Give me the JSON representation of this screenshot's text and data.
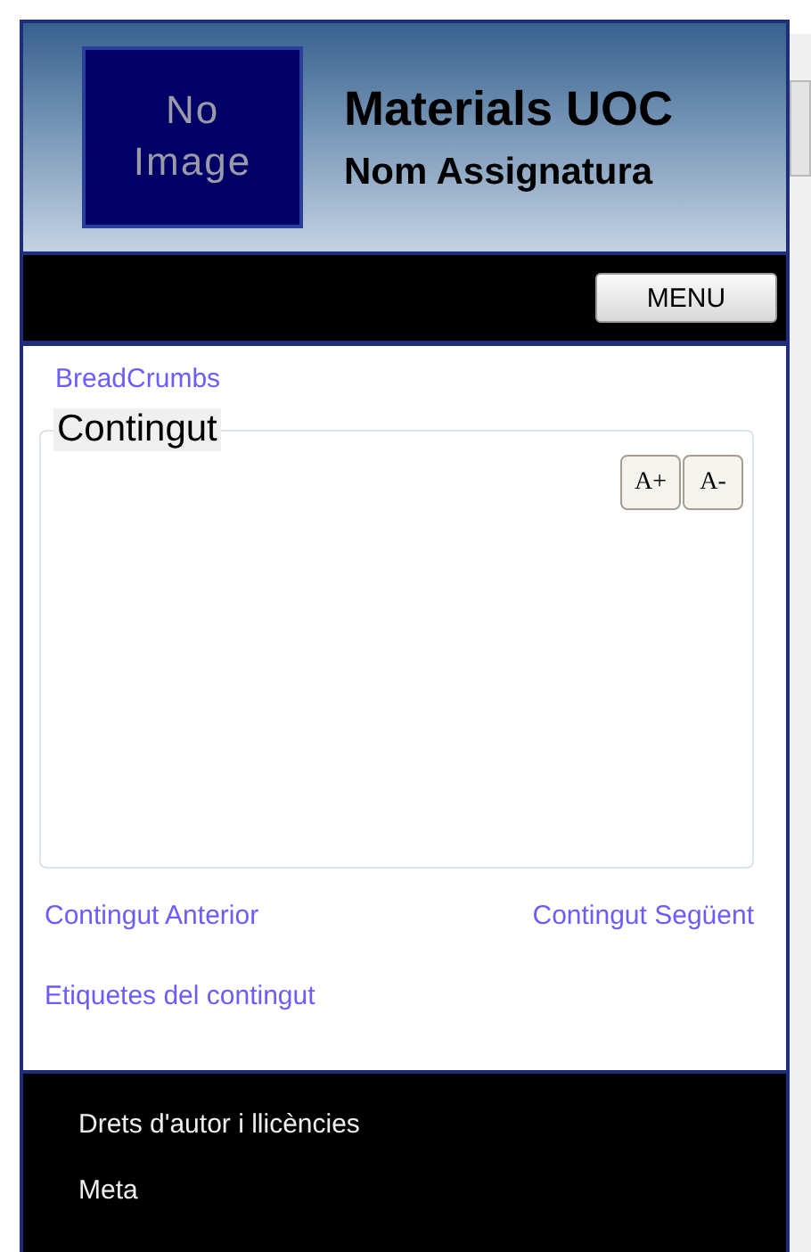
{
  "header": {
    "logo_placeholder": "No Image",
    "title": "Materials UOC",
    "subtitle": "Nom Assignatura"
  },
  "nav": {
    "menu_button": "MENU"
  },
  "breadcrumbs": "BreadCrumbs",
  "content": {
    "legend": "Contingut",
    "font_buttons": [
      "A+",
      "A-"
    ]
  },
  "pager": {
    "previous": "Contingut Anterior",
    "next": "Contingut Següent"
  },
  "tags_link": "Etiquetes del contingut",
  "footer": {
    "links": [
      "Drets d'autor i llicències",
      "Meta"
    ]
  }
}
